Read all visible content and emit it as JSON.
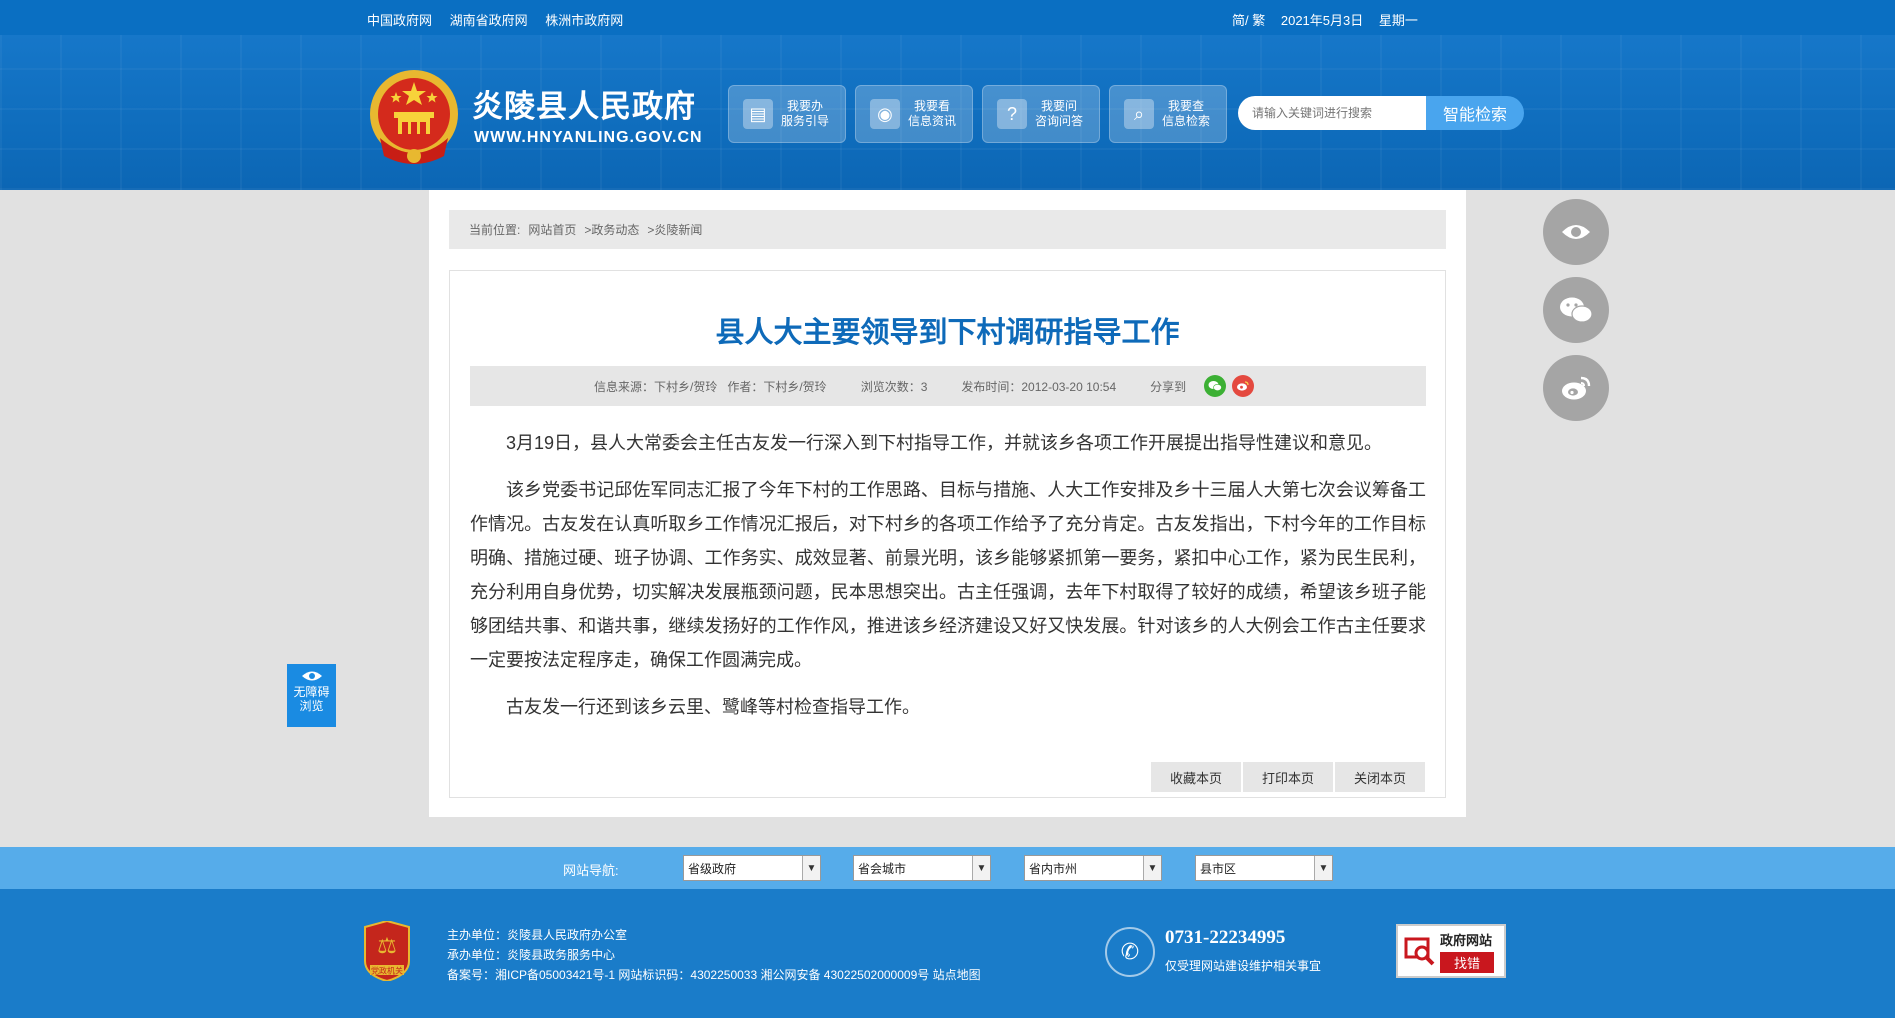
{
  "topbar": {
    "links": [
      "中国政府网",
      "湖南省政府网",
      "株洲市政府网"
    ],
    "lang": "简/ 繁",
    "date": "2021年5月3日",
    "weekday": "星期一"
  },
  "header": {
    "site_title": "炎陵县人民政府",
    "site_domain": "WWW.HNYANLING.GOV.CN",
    "services": [
      {
        "line1": "我要办",
        "line2": "服务引导",
        "icon": "document-icon"
      },
      {
        "line1": "我要看",
        "line2": "信息资讯",
        "icon": "eye-icon"
      },
      {
        "line1": "我要问",
        "line2": "咨询问答",
        "icon": "question-icon"
      },
      {
        "line1": "我要查",
        "line2": "信息检索",
        "icon": "magnifier-icon"
      }
    ],
    "search_placeholder": "请输入关键词进行搜索",
    "search_button": "智能检索"
  },
  "breadcrumb": {
    "prefix": "当前位置:",
    "items": [
      "网站首页",
      ">政务动态",
      ">炎陵新闻"
    ]
  },
  "article": {
    "title": "县人大主要领导到下村调研指导工作",
    "meta": {
      "source": "信息来源：下村乡/贺玲",
      "author": "作者：下村乡/贺玲",
      "views": "浏览次数：3",
      "published": "发布时间：2012-03-20 10:54",
      "share": "分享到"
    },
    "paragraphs": [
      "3月19日，县人大常委会主任古友发一行深入到下村指导工作，并就该乡各项工作开展提出指导性建议和意见。",
      "该乡党委书记邱佐军同志汇报了今年下村的工作思路、目标与措施、人大工作安排及乡十三届人大第七次会议筹备工作情况。古友发在认真听取乡工作情况汇报后，对下村乡的各项工作给予了充分肯定。古友发指出，下村今年的工作目标明确、措施过硬、班子协调、工作务实、成效显著、前景光明，该乡能够紧抓第一要务，紧扣中心工作，紧为民生民利，充分利用自身优势，切实解决发展瓶颈问题，民本思想突出。古主任强调，去年下村取得了较好的成绩，希望该乡班子能够团结共事、和谐共事，继续发扬好的工作作风，推进该乡经济建设又好又快发展。针对该乡的人大例会工作古主任要求一定要按法定程序走，确保工作圆满完成。",
      "古友发一行还到该乡云里、鹭峰等村检查指导工作。"
    ],
    "actions": [
      "收藏本页",
      "打印本页",
      "关闭本页"
    ]
  },
  "accessibility": {
    "line1": "无障碍",
    "line2": "浏览"
  },
  "navbar": {
    "label": "网站导航:",
    "selects": [
      "省级政府",
      "省会城市",
      "省内市州",
      "县市区"
    ]
  },
  "footer": {
    "badge_text": "党政机关",
    "host": "主办单位：炎陵县人民政府办公室",
    "organizer": "承办单位：炎陵县政务服务中心",
    "record": "备案号：湘ICP备05003421号-1 网站标识码：4302250033 湘公网安备 43022502000009号 站点地图",
    "phone": "0731-22234995",
    "phone_note": "仅受理网站建设维护相关事宜",
    "err_line1": "政府网站",
    "err_line2": "找错"
  },
  "colors": {
    "brand_blue": "#0a6fc2",
    "title_blue": "#0e6ab9",
    "navbar_blue": "#56acea",
    "footer_blue": "#1a7cc9"
  }
}
